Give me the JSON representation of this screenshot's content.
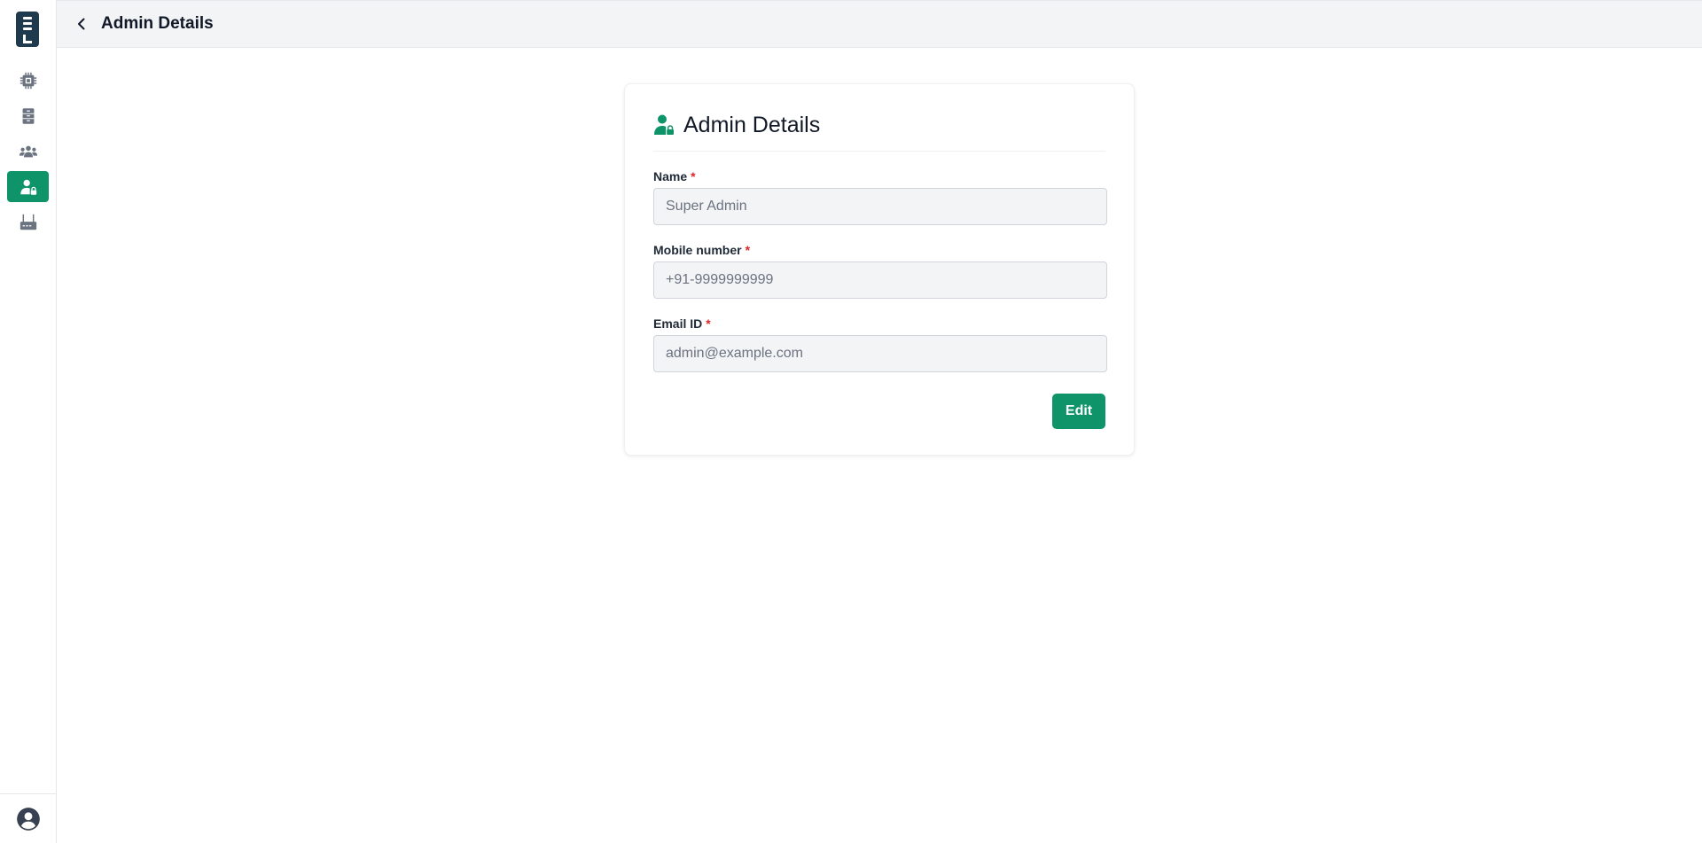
{
  "app": {
    "title": "Admin Details"
  },
  "sidebar": {
    "items": [
      {
        "icon": "chip-icon",
        "active": false
      },
      {
        "icon": "server-icon",
        "active": false
      },
      {
        "icon": "users-icon",
        "active": false
      },
      {
        "icon": "admin-user-icon",
        "active": true
      },
      {
        "icon": "router-icon",
        "active": false
      }
    ],
    "footer_icon": "account-circle-icon"
  },
  "header": {
    "title": "Admin Details",
    "back_icon": "chevron-left-icon"
  },
  "card": {
    "title": "Admin Details",
    "icon": "admin-user-icon",
    "fields": [
      {
        "label": "Name",
        "required_mark": "*",
        "placeholder": "Super Admin",
        "value": ""
      },
      {
        "label": "Mobile number",
        "required_mark": "*",
        "placeholder": "+91-9999999999",
        "value": ""
      },
      {
        "label": "Email ID",
        "required_mark": "*",
        "placeholder": "admin@example.com",
        "value": ""
      }
    ],
    "edit_label": "Edit"
  },
  "colors": {
    "accent": "#0e9468",
    "logo": "#1e3a4c",
    "required": "#dc2626",
    "icon_gray": "#6b7280"
  }
}
